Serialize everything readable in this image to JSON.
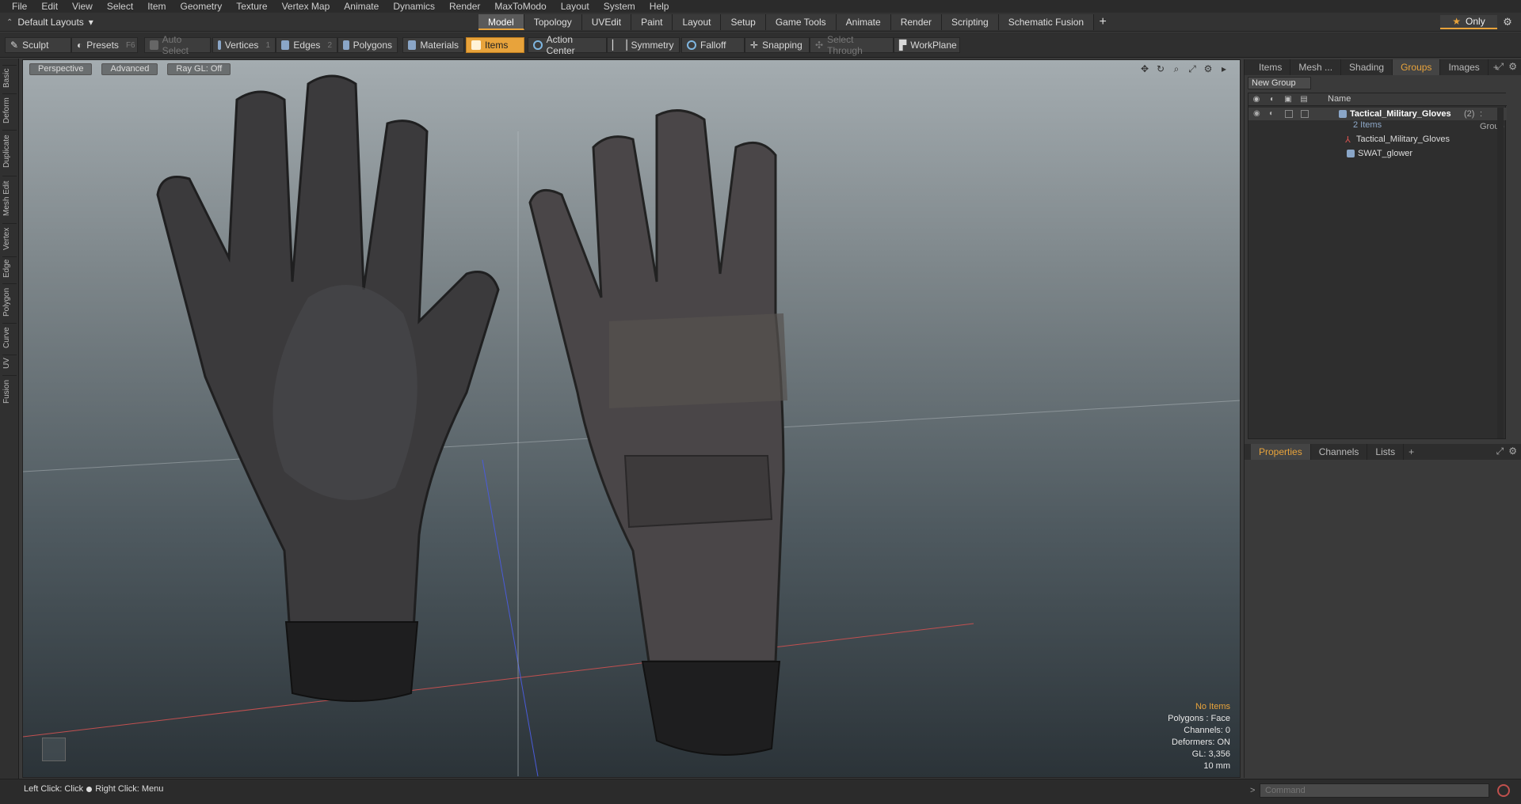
{
  "menu": [
    "File",
    "Edit",
    "View",
    "Select",
    "Item",
    "Geometry",
    "Texture",
    "Vertex Map",
    "Animate",
    "Dynamics",
    "Render",
    "MaxToModo",
    "Layout",
    "System",
    "Help"
  ],
  "layout": {
    "selector_label": "Default Layouts",
    "tabs": [
      "Model",
      "Topology",
      "UVEdit",
      "Paint",
      "Layout",
      "Setup",
      "Game Tools",
      "Animate",
      "Render",
      "Scripting",
      "Schematic Fusion"
    ],
    "active_tab": "Model",
    "add_tab": "+",
    "only_label": "Only"
  },
  "toolbar": {
    "sculpt": "Sculpt",
    "presets": "Presets",
    "presets_key": "F6",
    "auto_select": "Auto Select",
    "vertices": "Vertices",
    "vertices_key": "1",
    "edges": "Edges",
    "edges_key": "2",
    "polygons": "Polygons",
    "materials": "Materials",
    "items": "Items",
    "action_center": "Action Center",
    "symmetry": "Symmetry",
    "falloff": "Falloff",
    "snapping": "Snapping",
    "select_through": "Select Through",
    "workplane": "WorkPlane"
  },
  "left_tabs": [
    "Basic",
    "Deform",
    "Duplicate",
    "Mesh Edit",
    "Vertex",
    "Edge",
    "Polygon",
    "Curve",
    "UV",
    "Fusion"
  ],
  "viewport": {
    "view_mode": "Perspective",
    "shading": "Advanced",
    "raygl": "Ray GL: Off",
    "hud": {
      "no_items": "No Items",
      "polygons": "Polygons : Face",
      "channels": "Channels: 0",
      "deformers": "Deformers: ON",
      "gl": "GL: 3,356",
      "scale": "10 mm"
    }
  },
  "right_panel": {
    "tabs": [
      "Items",
      "Mesh ...",
      "Shading",
      "Groups",
      "Images"
    ],
    "active_tab": "Groups",
    "new_group": "New Group",
    "col_name": "Name",
    "group": {
      "name": "Tactical_Military_Gloves",
      "count": "(2)",
      "type": ": Group",
      "items_label": "2 Items"
    },
    "children": [
      "Tactical_Military_Gloves",
      "SWAT_glower"
    ],
    "bottom_tabs": [
      "Properties",
      "Channels",
      "Lists"
    ],
    "bottom_active": "Properties"
  },
  "status": {
    "left_click": "Left Click: Click",
    "right_click": "Right Click: Menu"
  },
  "command": {
    "placeholder": "Command"
  },
  "colors": {
    "accent": "#e8a33b"
  }
}
